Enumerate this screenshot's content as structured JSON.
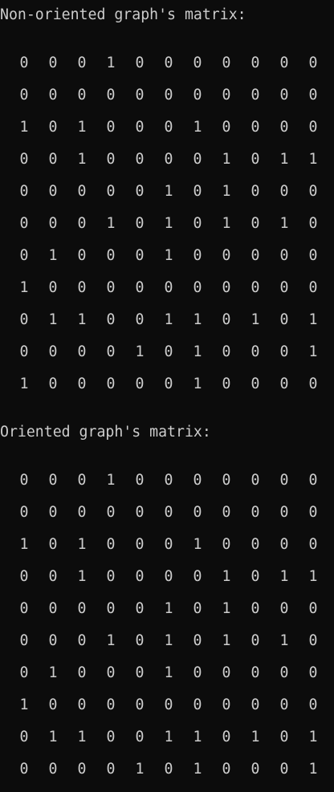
{
  "console": {
    "top_fragment": "-----",
    "sections": [
      {
        "heading": "Non-oriented graph's matrix:",
        "rows": [
          [
            "0",
            "0",
            "0",
            "1",
            "0",
            "0",
            "0",
            "0",
            "0",
            "0",
            "0"
          ],
          [
            "0",
            "0",
            "0",
            "0",
            "0",
            "0",
            "0",
            "0",
            "0",
            "0",
            "0"
          ],
          [
            "1",
            "0",
            "1",
            "0",
            "0",
            "0",
            "1",
            "0",
            "0",
            "0",
            "0"
          ],
          [
            "0",
            "0",
            "1",
            "0",
            "0",
            "0",
            "0",
            "1",
            "0",
            "1",
            "1"
          ],
          [
            "0",
            "0",
            "0",
            "0",
            "0",
            "1",
            "0",
            "1",
            "0",
            "0",
            "0"
          ],
          [
            "0",
            "0",
            "0",
            "1",
            "0",
            "1",
            "0",
            "1",
            "0",
            "1",
            "0"
          ],
          [
            "0",
            "1",
            "0",
            "0",
            "0",
            "1",
            "0",
            "0",
            "0",
            "0",
            "0"
          ],
          [
            "1",
            "0",
            "0",
            "0",
            "0",
            "0",
            "0",
            "0",
            "0",
            "0",
            "0"
          ],
          [
            "0",
            "1",
            "1",
            "0",
            "0",
            "1",
            "1",
            "0",
            "1",
            "0",
            "1"
          ],
          [
            "0",
            "0",
            "0",
            "0",
            "1",
            "0",
            "1",
            "0",
            "0",
            "0",
            "1"
          ],
          [
            "1",
            "0",
            "0",
            "0",
            "0",
            "0",
            "1",
            "0",
            "0",
            "0",
            "0"
          ]
        ]
      },
      {
        "heading": "Oriented graph's matrix:",
        "rows": [
          [
            "0",
            "0",
            "0",
            "1",
            "0",
            "0",
            "0",
            "0",
            "0",
            "0",
            "0"
          ],
          [
            "0",
            "0",
            "0",
            "0",
            "0",
            "0",
            "0",
            "0",
            "0",
            "0",
            "0"
          ],
          [
            "1",
            "0",
            "1",
            "0",
            "0",
            "0",
            "1",
            "0",
            "0",
            "0",
            "0"
          ],
          [
            "0",
            "0",
            "1",
            "0",
            "0",
            "0",
            "0",
            "1",
            "0",
            "1",
            "1"
          ],
          [
            "0",
            "0",
            "0",
            "0",
            "0",
            "1",
            "0",
            "1",
            "0",
            "0",
            "0"
          ],
          [
            "0",
            "0",
            "0",
            "1",
            "0",
            "1",
            "0",
            "1",
            "0",
            "1",
            "0"
          ],
          [
            "0",
            "1",
            "0",
            "0",
            "0",
            "1",
            "0",
            "0",
            "0",
            "0",
            "0"
          ],
          [
            "1",
            "0",
            "0",
            "0",
            "0",
            "0",
            "0",
            "0",
            "0",
            "0",
            "0"
          ],
          [
            "0",
            "1",
            "1",
            "0",
            "0",
            "1",
            "1",
            "0",
            "1",
            "0",
            "1"
          ],
          [
            "0",
            "0",
            "0",
            "0",
            "1",
            "0",
            "1",
            "0",
            "0",
            "0",
            "1"
          ]
        ]
      }
    ]
  }
}
